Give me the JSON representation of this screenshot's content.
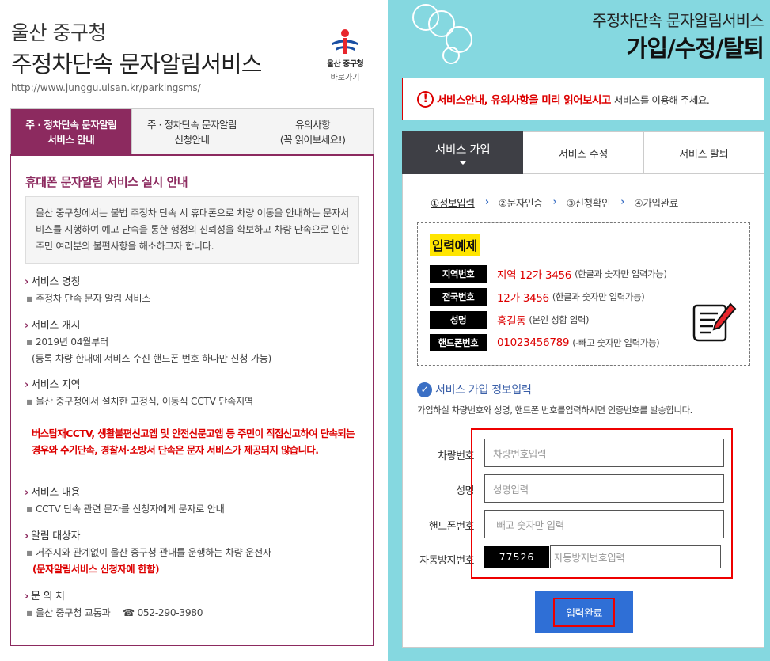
{
  "header": {
    "city": "울산 중구청",
    "service_title": "주정차단속 문자알림서비스",
    "url": "http://www.junggu.ulsan.kr/parkingsms/",
    "logo_name": "울산 중구청",
    "logo_link": "바로가기"
  },
  "left_tabs": [
    {
      "label": "주 · 정차단속 문자알림\n서비스 안내"
    },
    {
      "label": "주 · 정차단속 문자알림\n신청안내"
    },
    {
      "label": "유의사항\n(꼭 읽어보세요!)"
    }
  ],
  "notice": {
    "heading": "휴대폰 문자알림 서비스 실시 안내",
    "intro": "울산 중구청에서는 불법 주정차 단속 시 휴대폰으로 차량 이동을 안내하는 문자서비스를 시행하여 예고 단속을 통한 행정의 신뢰성을 확보하고 차량 단속으로 인한 주민 여러분의 불편사항을 해소하고자 합니다."
  },
  "sections": {
    "name_h": "서비스 명칭",
    "name_b": "주정차 단속 문자 알림 서비스",
    "start_h": "서비스 개시",
    "start_b": "2019년 04월부터",
    "start_b2": "(등록 차량 한대에 서비스 수신 핸드폰 번호 하나만 신청 가능)",
    "area_h": "서비스 지역",
    "area_b": "울산 중구청에서 설치한 고정식, 이동식 CCTV 단속지역",
    "warning": "버스탑재CCTV, 생활불편신고앱 및 안전신문고앱 등 주민이 직접신고하여 단속되는 경우와 수기단속, 경찰서·소방서 단속은 문자 서비스가 제공되지 않습니다.",
    "content_h": "서비스 내용",
    "content_b": "CCTV 단속 관련 문자를 신청자에게 문자로 안내",
    "target_h": "알림 대상자",
    "target_b": "거주지와 관계없이 울산 중구청 관내를 운행하는 차량 운전자",
    "target_b2": "(문자알림서비스 신청자에 한함)",
    "contact_h": "문 의 처",
    "contact_dept": "울산 중구청 교통과",
    "contact_phone": "052-290-3980"
  },
  "right": {
    "subtitle": "주정차단속 문자알림서비스",
    "title": "가입/수정/탈퇴",
    "alert_strong": "서비스안내, 유의사항을 미리 읽어보시고",
    "alert_rest": "서비스를 이용해 주세요.",
    "tabs": [
      {
        "label": "서비스 가입"
      },
      {
        "label": "서비스 수정"
      },
      {
        "label": "서비스 탈퇴"
      }
    ],
    "steps": [
      "①정보입력",
      "②문자인증",
      "③신청확인",
      "④가입완료"
    ],
    "example": {
      "title": "입력예제",
      "rows": [
        {
          "label": "지역번호",
          "value": "지역 12가 3456",
          "note": "(한글과 숫자만 입력가능)"
        },
        {
          "label": "전국번호",
          "value": "12가 3456",
          "note": "(한글과 숫자만 입력가능)"
        },
        {
          "label": "성명",
          "value": "홍길동",
          "note": "(본인 성함 입력)"
        },
        {
          "label": "핸드폰번호",
          "value": "01023456789",
          "note": "(-빼고 숫자만 입력가능)"
        }
      ]
    },
    "info_heading": "서비스 가입 정보입력",
    "info_sub": "가입하실 차량번호와 성명, 핸드폰 번호를입력하시면 인증번호를 발송합니다.",
    "form": {
      "car_label": "차량번호",
      "car_placeholder": "차량번호입력",
      "name_label": "성명",
      "name_placeholder": "성명입력",
      "phone_label": "핸드폰번호",
      "phone_placeholder": "-빼고 숫자만 입력",
      "captcha_label": "자동방지번호",
      "captcha_code": "77526",
      "captcha_placeholder": "자동방지번호입력"
    },
    "submit_label": "입력완료"
  }
}
